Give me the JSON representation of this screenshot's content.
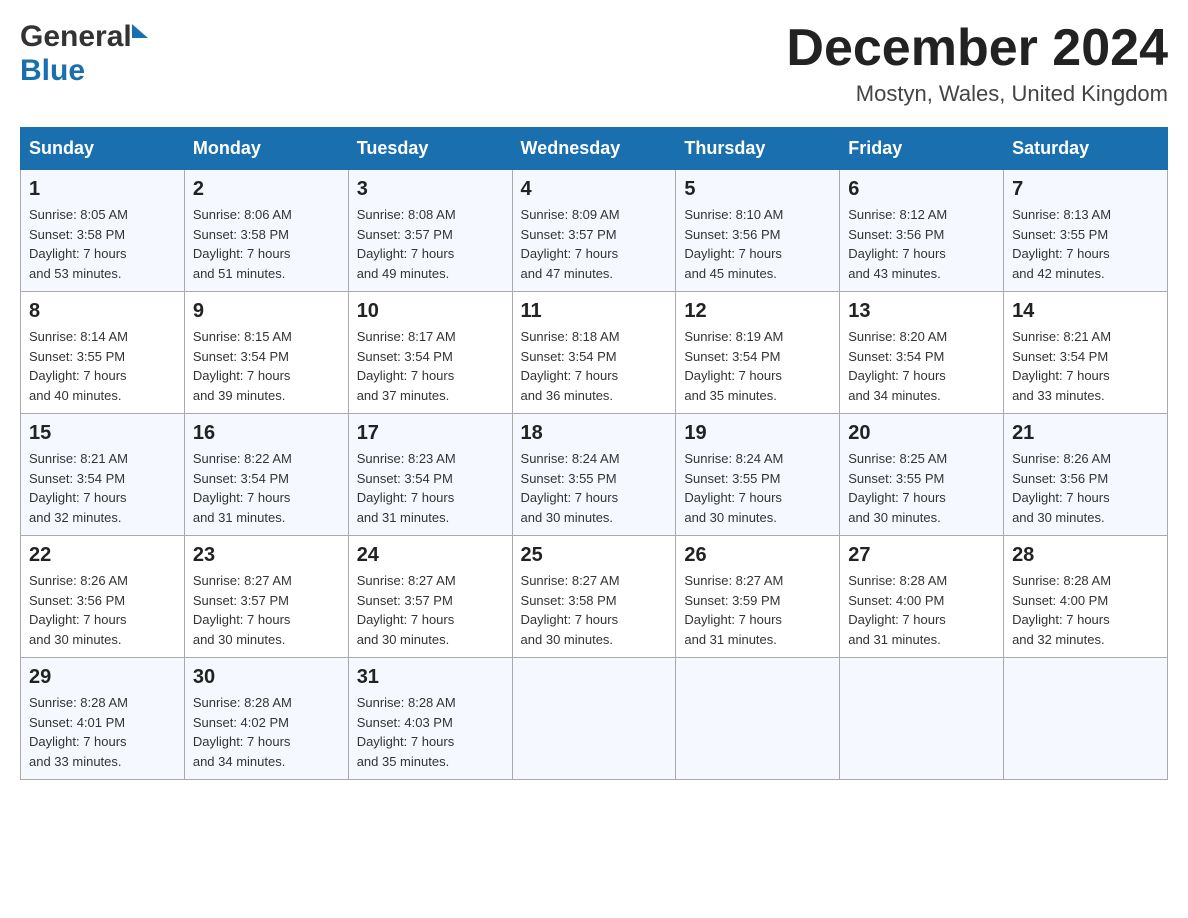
{
  "header": {
    "logo_general": "General",
    "logo_blue": "Blue",
    "month_title": "December 2024",
    "location": "Mostyn, Wales, United Kingdom"
  },
  "days_of_week": [
    "Sunday",
    "Monday",
    "Tuesday",
    "Wednesday",
    "Thursday",
    "Friday",
    "Saturday"
  ],
  "weeks": [
    [
      {
        "day": "1",
        "info": "Sunrise: 8:05 AM\nSunset: 3:58 PM\nDaylight: 7 hours\nand 53 minutes."
      },
      {
        "day": "2",
        "info": "Sunrise: 8:06 AM\nSunset: 3:58 PM\nDaylight: 7 hours\nand 51 minutes."
      },
      {
        "day": "3",
        "info": "Sunrise: 8:08 AM\nSunset: 3:57 PM\nDaylight: 7 hours\nand 49 minutes."
      },
      {
        "day": "4",
        "info": "Sunrise: 8:09 AM\nSunset: 3:57 PM\nDaylight: 7 hours\nand 47 minutes."
      },
      {
        "day": "5",
        "info": "Sunrise: 8:10 AM\nSunset: 3:56 PM\nDaylight: 7 hours\nand 45 minutes."
      },
      {
        "day": "6",
        "info": "Sunrise: 8:12 AM\nSunset: 3:56 PM\nDaylight: 7 hours\nand 43 minutes."
      },
      {
        "day": "7",
        "info": "Sunrise: 8:13 AM\nSunset: 3:55 PM\nDaylight: 7 hours\nand 42 minutes."
      }
    ],
    [
      {
        "day": "8",
        "info": "Sunrise: 8:14 AM\nSunset: 3:55 PM\nDaylight: 7 hours\nand 40 minutes."
      },
      {
        "day": "9",
        "info": "Sunrise: 8:15 AM\nSunset: 3:54 PM\nDaylight: 7 hours\nand 39 minutes."
      },
      {
        "day": "10",
        "info": "Sunrise: 8:17 AM\nSunset: 3:54 PM\nDaylight: 7 hours\nand 37 minutes."
      },
      {
        "day": "11",
        "info": "Sunrise: 8:18 AM\nSunset: 3:54 PM\nDaylight: 7 hours\nand 36 minutes."
      },
      {
        "day": "12",
        "info": "Sunrise: 8:19 AM\nSunset: 3:54 PM\nDaylight: 7 hours\nand 35 minutes."
      },
      {
        "day": "13",
        "info": "Sunrise: 8:20 AM\nSunset: 3:54 PM\nDaylight: 7 hours\nand 34 minutes."
      },
      {
        "day": "14",
        "info": "Sunrise: 8:21 AM\nSunset: 3:54 PM\nDaylight: 7 hours\nand 33 minutes."
      }
    ],
    [
      {
        "day": "15",
        "info": "Sunrise: 8:21 AM\nSunset: 3:54 PM\nDaylight: 7 hours\nand 32 minutes."
      },
      {
        "day": "16",
        "info": "Sunrise: 8:22 AM\nSunset: 3:54 PM\nDaylight: 7 hours\nand 31 minutes."
      },
      {
        "day": "17",
        "info": "Sunrise: 8:23 AM\nSunset: 3:54 PM\nDaylight: 7 hours\nand 31 minutes."
      },
      {
        "day": "18",
        "info": "Sunrise: 8:24 AM\nSunset: 3:55 PM\nDaylight: 7 hours\nand 30 minutes."
      },
      {
        "day": "19",
        "info": "Sunrise: 8:24 AM\nSunset: 3:55 PM\nDaylight: 7 hours\nand 30 minutes."
      },
      {
        "day": "20",
        "info": "Sunrise: 8:25 AM\nSunset: 3:55 PM\nDaylight: 7 hours\nand 30 minutes."
      },
      {
        "day": "21",
        "info": "Sunrise: 8:26 AM\nSunset: 3:56 PM\nDaylight: 7 hours\nand 30 minutes."
      }
    ],
    [
      {
        "day": "22",
        "info": "Sunrise: 8:26 AM\nSunset: 3:56 PM\nDaylight: 7 hours\nand 30 minutes."
      },
      {
        "day": "23",
        "info": "Sunrise: 8:27 AM\nSunset: 3:57 PM\nDaylight: 7 hours\nand 30 minutes."
      },
      {
        "day": "24",
        "info": "Sunrise: 8:27 AM\nSunset: 3:57 PM\nDaylight: 7 hours\nand 30 minutes."
      },
      {
        "day": "25",
        "info": "Sunrise: 8:27 AM\nSunset: 3:58 PM\nDaylight: 7 hours\nand 30 minutes."
      },
      {
        "day": "26",
        "info": "Sunrise: 8:27 AM\nSunset: 3:59 PM\nDaylight: 7 hours\nand 31 minutes."
      },
      {
        "day": "27",
        "info": "Sunrise: 8:28 AM\nSunset: 4:00 PM\nDaylight: 7 hours\nand 31 minutes."
      },
      {
        "day": "28",
        "info": "Sunrise: 8:28 AM\nSunset: 4:00 PM\nDaylight: 7 hours\nand 32 minutes."
      }
    ],
    [
      {
        "day": "29",
        "info": "Sunrise: 8:28 AM\nSunset: 4:01 PM\nDaylight: 7 hours\nand 33 minutes."
      },
      {
        "day": "30",
        "info": "Sunrise: 8:28 AM\nSunset: 4:02 PM\nDaylight: 7 hours\nand 34 minutes."
      },
      {
        "day": "31",
        "info": "Sunrise: 8:28 AM\nSunset: 4:03 PM\nDaylight: 7 hours\nand 35 minutes."
      },
      {
        "day": "",
        "info": ""
      },
      {
        "day": "",
        "info": ""
      },
      {
        "day": "",
        "info": ""
      },
      {
        "day": "",
        "info": ""
      }
    ]
  ]
}
